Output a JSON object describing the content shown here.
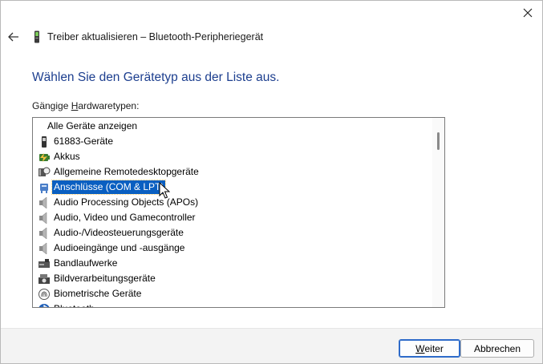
{
  "window": {
    "title": "Treiber aktualisieren – Bluetooth-Peripheriegerät",
    "close_icon": "close-icon",
    "back_icon": "back-arrow-icon"
  },
  "main": {
    "heading": "Wählen Sie den Gerätetyp aus der Liste aus.",
    "list_caption_pre": "Gängige ",
    "list_caption_underlined": "H",
    "list_caption_post": "ardwaretypen:"
  },
  "hardware_list": {
    "items": [
      {
        "label": "Alle Geräte anzeigen",
        "icon": "none"
      },
      {
        "label": "61883-Geräte",
        "icon": "device-icon"
      },
      {
        "label": "Akkus",
        "icon": "battery-icon"
      },
      {
        "label": "Allgemeine Remotedesktopgeräte",
        "icon": "remote-desktop-icon"
      },
      {
        "label": "Anschlüsse (COM & LPT)",
        "icon": "port-icon",
        "selected": true
      },
      {
        "label": "Audio Processing Objects (APOs)",
        "icon": "speaker-icon"
      },
      {
        "label": "Audio, Video und Gamecontroller",
        "icon": "speaker-icon"
      },
      {
        "label": "Audio-/Videosteuerungsgeräte",
        "icon": "speaker-icon"
      },
      {
        "label": "Audioeingänge und -ausgänge",
        "icon": "speaker-icon"
      },
      {
        "label": "Bandlaufwerke",
        "icon": "tape-drive-icon"
      },
      {
        "label": "Bildverarbeitungsgeräte",
        "icon": "camera-icon"
      },
      {
        "label": "Biometrische Geräte",
        "icon": "fingerprint-icon"
      },
      {
        "label": "Bluetooth",
        "icon": "bluetooth-icon"
      }
    ]
  },
  "footer": {
    "next_label_underlined": "W",
    "next_label_rest": "eiter",
    "cancel_label": "Abbrechen"
  },
  "colors": {
    "heading": "#1d3f8f",
    "selection": "#0a5fc1",
    "default_button_border": "#2e6bc9"
  }
}
